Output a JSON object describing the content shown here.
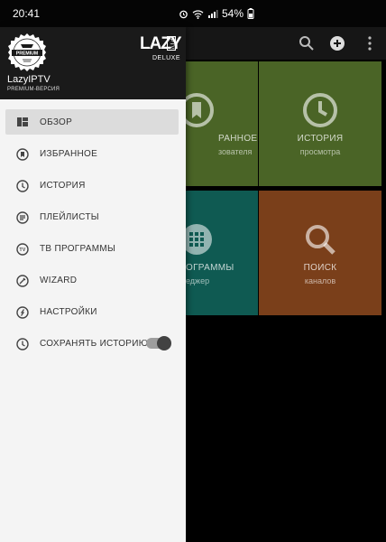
{
  "status_bar": {
    "time": "20:41",
    "battery": "54%"
  },
  "colors": {
    "tile_green": "#4a6426",
    "tile_teal": "#0f5a52",
    "tile_brown": "#7a3f1a",
    "drawer_bg": "#f4f4f4",
    "header_bg": "#1a1a1a"
  },
  "appbar": {
    "icons": [
      "search-icon",
      "add-circle-icon",
      "more-vert-icon"
    ]
  },
  "tiles": [
    {
      "title": "РАННОЕ",
      "subtitle": "зователя",
      "icon": "bookmark-icon"
    },
    {
      "title": "ИСТОРИЯ",
      "subtitle": "просмотра",
      "icon": "clock-icon"
    },
    {
      "title": "ОГРАММЫ",
      "subtitle": "еджер",
      "icon": "grid-icon"
    },
    {
      "title": "ПОИСК",
      "subtitle": "каналов",
      "icon": "search-icon"
    }
  ],
  "drawer": {
    "badge_text": "PREMIUM",
    "logo_main": "LAZY",
    "logo_tv": "IPTV",
    "logo_sub": "DELUXE",
    "app_name": "LazyIPTV",
    "version": "PREMIUM-ВЕРСИЯ",
    "menu": [
      {
        "label": "ОБЗОР",
        "icon": "dashboard-icon",
        "active": true
      },
      {
        "label": "ИЗБРАННОЕ",
        "icon": "bookmark-icon"
      },
      {
        "label": "ИСТОРИЯ",
        "icon": "clock-icon"
      },
      {
        "label": "ПЛЕЙЛИСТЫ",
        "icon": "playlist-icon"
      },
      {
        "label": "ТВ ПРОГРАММЫ",
        "icon": "tv-guide-icon"
      },
      {
        "label": "WIZARD",
        "icon": "wizard-icon"
      },
      {
        "label": "НАСТРОЙКИ",
        "icon": "settings-icon"
      },
      {
        "label": "СОХРАНЯТЬ ИСТОРИЮ",
        "icon": "history-save-icon",
        "toggle_on": true
      }
    ]
  }
}
